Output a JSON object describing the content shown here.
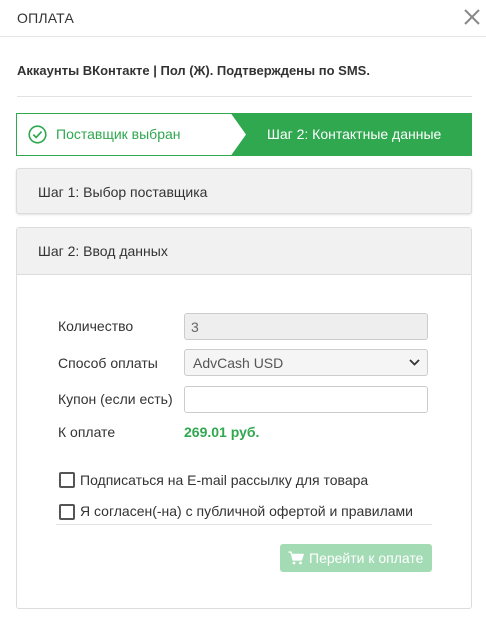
{
  "modal": {
    "title": "ОПЛАТА"
  },
  "product": {
    "title": "Аккаунты ВКонтакте | Пол (Ж). Подтверждены по SMS."
  },
  "stepper": {
    "step1": {
      "label": "Поставщик выбран",
      "status": "done"
    },
    "step2": {
      "label": "Шаг 2: Контактные данные",
      "status": "active"
    }
  },
  "panels": {
    "step1_title": "Шаг 1: Выбор поставщика",
    "step2_title": "Шаг 2: Ввод данных"
  },
  "form": {
    "quantity_label": "Количество",
    "quantity_value": "3",
    "payment_label": "Способ оплаты",
    "payment_value": "AdvCash USD",
    "coupon_label": "Купон (если есть)",
    "coupon_value": "",
    "total_label": "К оплате",
    "total_value": "269.01 руб.",
    "subscribe_label": "Подписаться на E-mail рассылку для товара",
    "agree_label": "Я согласен(-на) с публичной офертой и правилами",
    "subscribe_checked": false,
    "agree_checked": false
  },
  "actions": {
    "pay_label": "Перейти к оплате",
    "pay_enabled": false
  },
  "colors": {
    "accent": "#2fa84f",
    "accent_disabled": "#a3dbb4",
    "panel_header_bg": "#f1f1f1",
    "border": "#dcdcdc"
  },
  "icons": {
    "close": "close-icon",
    "step_done": "check-circle-icon",
    "dropdown": "chevron-down-icon",
    "pay": "cart-icon"
  }
}
